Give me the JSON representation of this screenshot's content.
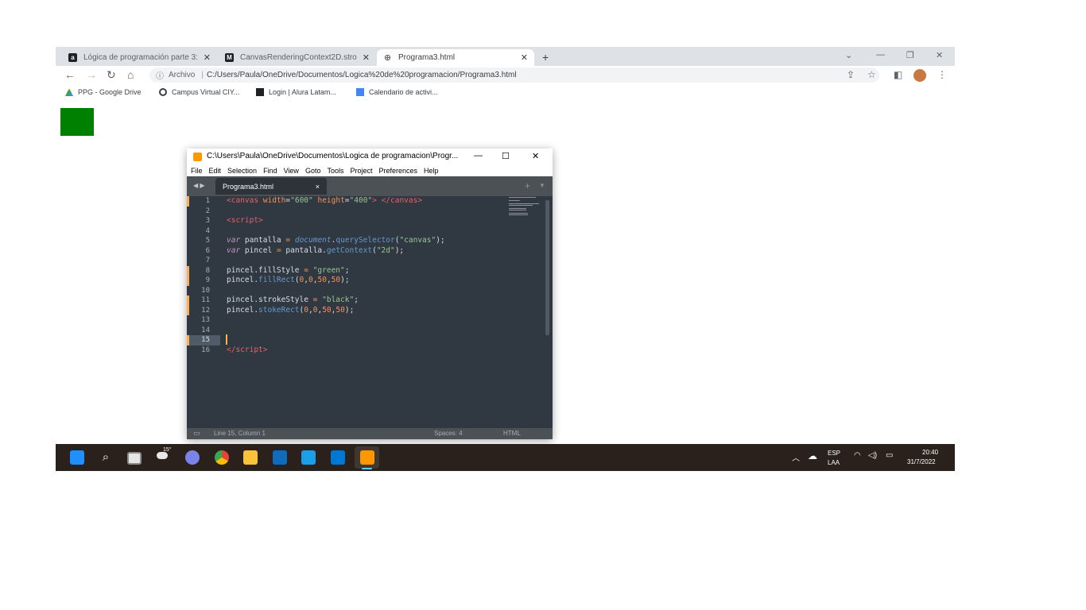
{
  "browser": {
    "tabs": [
      {
        "title": "Lógica de programación parte 3:",
        "favicon": "alura-icon"
      },
      {
        "title": "CanvasRenderingContext2D.stro",
        "favicon": "mdn-icon"
      },
      {
        "title": "Programa3.html",
        "favicon": "globe-icon"
      }
    ],
    "new_tab_symbol": "+",
    "toolbar": {
      "security_label": "Archivo",
      "url": "C:/Users/Paula/OneDrive/Documentos/Logica%20de%20programacion/Programa3.html"
    },
    "bookmarks": [
      {
        "label": "PPG - Google Drive",
        "icon": "google-drive-icon"
      },
      {
        "label": "Campus Virtual CIY...",
        "icon": "campus-icon"
      },
      {
        "label": "Login | Alura Latam...",
        "icon": "alura-icon"
      },
      {
        "label": "Calendario de activi...",
        "icon": "calendar-icon"
      }
    ],
    "canvas_fill": "#008000"
  },
  "sublime": {
    "title": "C:\\Users\\Paula\\OneDrive\\Documentos\\Logica de programacion\\Progr...",
    "menu": [
      "File",
      "Edit",
      "Selection",
      "Find",
      "View",
      "Goto",
      "Tools",
      "Project",
      "Preferences",
      "Help"
    ],
    "tab": {
      "label": "Programa3.html",
      "close": "×"
    },
    "line_numbers": [
      "1",
      "2",
      "3",
      "4",
      "5",
      "6",
      "7",
      "8",
      "9",
      "10",
      "11",
      "12",
      "13",
      "14",
      "15",
      "16"
    ],
    "current_line": 15,
    "status": {
      "position": "Line 15, Column 1",
      "spaces": "Spaces: 4",
      "syntax": "HTML"
    }
  },
  "taskbar": {
    "weather": "15°",
    "language": "ESP",
    "layout": "LAA",
    "time": "20:40",
    "date": "31/7/2022"
  },
  "colors": {
    "editor_bg": "#303841",
    "accent_orange": "#f9ae58",
    "canvas_green": "#008000",
    "taskbar_bg": "#2a211c"
  }
}
